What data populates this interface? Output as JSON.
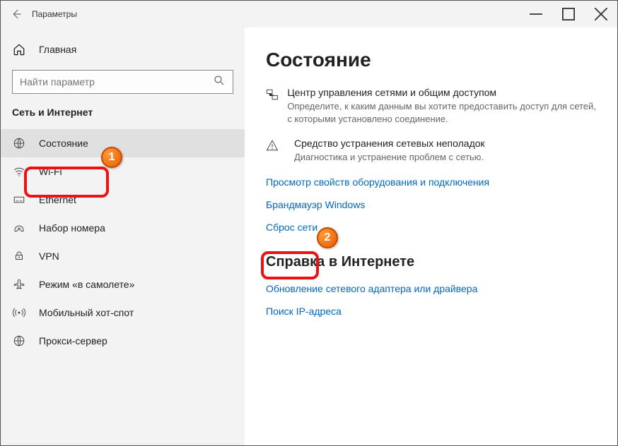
{
  "window": {
    "app_title": "Параметры"
  },
  "sidebar": {
    "home_label": "Главная",
    "search_placeholder": "Найти параметр",
    "category": "Сеть и Интернет",
    "items": [
      {
        "label": "Состояние"
      },
      {
        "label": "Wi-Fi"
      },
      {
        "label": "Ethernet"
      },
      {
        "label": "Набор номера"
      },
      {
        "label": "VPN"
      },
      {
        "label": "Режим «в самолете»"
      },
      {
        "label": "Мобильный хот-спот"
      },
      {
        "label": "Прокси-сервер"
      }
    ]
  },
  "main": {
    "title": "Состояние",
    "rows": [
      {
        "title": "Центр управления сетями и общим доступом",
        "desc": "Определите, к каким данным вы хотите предоставить доступ для сетей, с которыми установлено соединение."
      },
      {
        "title": "Средство устранения сетевых неполадок",
        "desc": "Диагностика и устранение проблем с сетью."
      }
    ],
    "links": [
      "Просмотр свойств оборудования и подключения",
      "Брандмауэр Windows",
      "Сброс сети"
    ],
    "help_title": "Справка в Интернете",
    "help_links": [
      "Обновление сетевого адаптера или драйвера",
      "Поиск IP-адреса"
    ]
  },
  "annotations": {
    "badge1": "1",
    "badge2": "2"
  }
}
